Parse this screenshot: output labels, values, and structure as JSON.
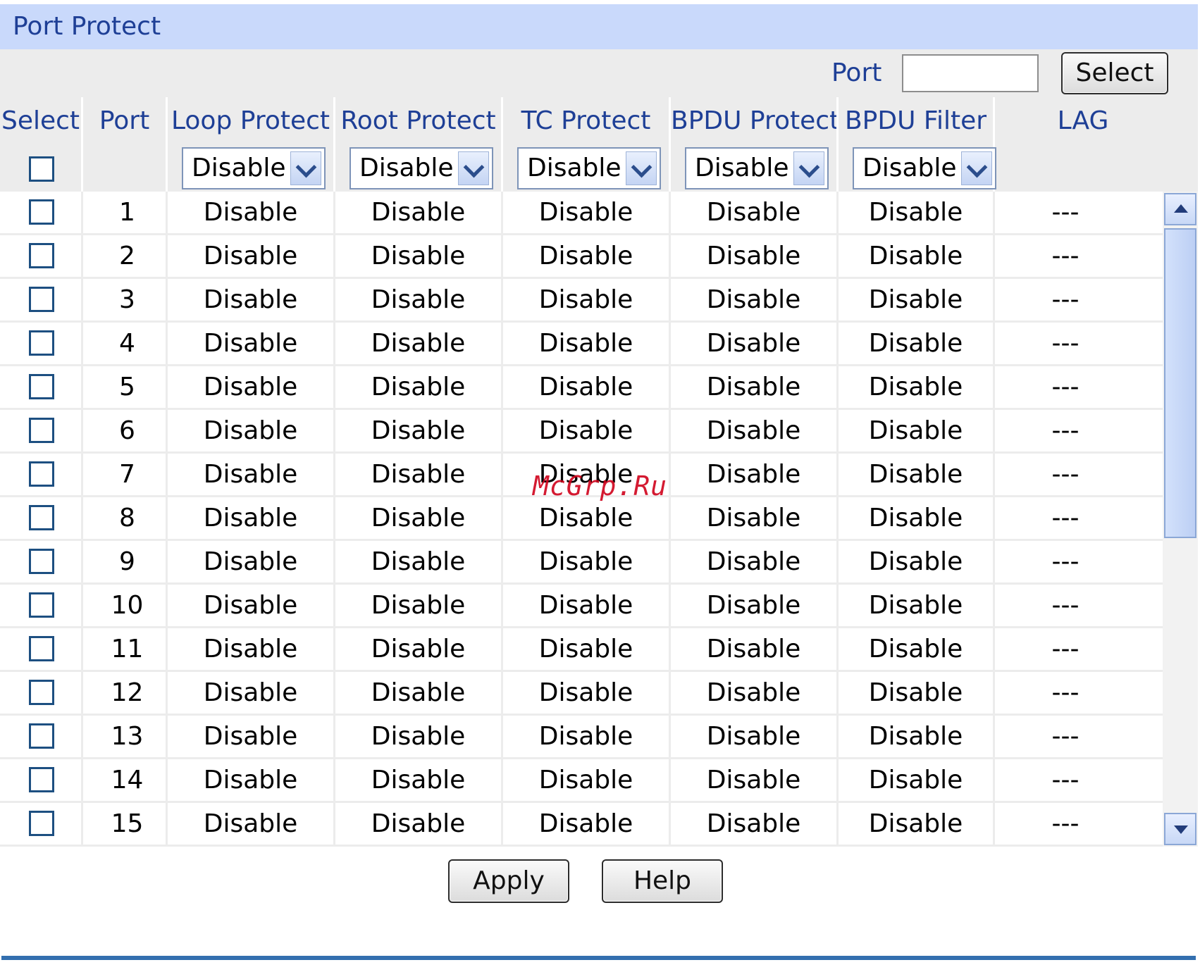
{
  "section": {
    "title": "Port Protect"
  },
  "toolbar": {
    "port_label": "Port",
    "port_value": "",
    "select_label": "Select"
  },
  "columns": {
    "select": "Select",
    "port": "Port",
    "loop": "Loop Protect",
    "root": "Root Protect",
    "tc": "TC Protect",
    "bpdu_protect": "BPDU Protect",
    "bpdu_filter": "BPDU Filter",
    "lag": "LAG"
  },
  "filters": {
    "loop": "Disable",
    "root": "Disable",
    "tc": "Disable",
    "bpdu_protect": "Disable",
    "bpdu_filter": "Disable"
  },
  "rows": [
    {
      "port": "1",
      "loop": "Disable",
      "root": "Disable",
      "tc": "Disable",
      "bpdu_protect": "Disable",
      "bpdu_filter": "Disable",
      "lag": "---"
    },
    {
      "port": "2",
      "loop": "Disable",
      "root": "Disable",
      "tc": "Disable",
      "bpdu_protect": "Disable",
      "bpdu_filter": "Disable",
      "lag": "---"
    },
    {
      "port": "3",
      "loop": "Disable",
      "root": "Disable",
      "tc": "Disable",
      "bpdu_protect": "Disable",
      "bpdu_filter": "Disable",
      "lag": "---"
    },
    {
      "port": "4",
      "loop": "Disable",
      "root": "Disable",
      "tc": "Disable",
      "bpdu_protect": "Disable",
      "bpdu_filter": "Disable",
      "lag": "---"
    },
    {
      "port": "5",
      "loop": "Disable",
      "root": "Disable",
      "tc": "Disable",
      "bpdu_protect": "Disable",
      "bpdu_filter": "Disable",
      "lag": "---"
    },
    {
      "port": "6",
      "loop": "Disable",
      "root": "Disable",
      "tc": "Disable",
      "bpdu_protect": "Disable",
      "bpdu_filter": "Disable",
      "lag": "---"
    },
    {
      "port": "7",
      "loop": "Disable",
      "root": "Disable",
      "tc": "Disable",
      "bpdu_protect": "Disable",
      "bpdu_filter": "Disable",
      "lag": "---"
    },
    {
      "port": "8",
      "loop": "Disable",
      "root": "Disable",
      "tc": "Disable",
      "bpdu_protect": "Disable",
      "bpdu_filter": "Disable",
      "lag": "---"
    },
    {
      "port": "9",
      "loop": "Disable",
      "root": "Disable",
      "tc": "Disable",
      "bpdu_protect": "Disable",
      "bpdu_filter": "Disable",
      "lag": "---"
    },
    {
      "port": "10",
      "loop": "Disable",
      "root": "Disable",
      "tc": "Disable",
      "bpdu_protect": "Disable",
      "bpdu_filter": "Disable",
      "lag": "---"
    },
    {
      "port": "11",
      "loop": "Disable",
      "root": "Disable",
      "tc": "Disable",
      "bpdu_protect": "Disable",
      "bpdu_filter": "Disable",
      "lag": "---"
    },
    {
      "port": "12",
      "loop": "Disable",
      "root": "Disable",
      "tc": "Disable",
      "bpdu_protect": "Disable",
      "bpdu_filter": "Disable",
      "lag": "---"
    },
    {
      "port": "13",
      "loop": "Disable",
      "root": "Disable",
      "tc": "Disable",
      "bpdu_protect": "Disable",
      "bpdu_filter": "Disable",
      "lag": "---"
    },
    {
      "port": "14",
      "loop": "Disable",
      "root": "Disable",
      "tc": "Disable",
      "bpdu_protect": "Disable",
      "bpdu_filter": "Disable",
      "lag": "---"
    },
    {
      "port": "15",
      "loop": "Disable",
      "root": "Disable",
      "tc": "Disable",
      "bpdu_protect": "Disable",
      "bpdu_filter": "Disable",
      "lag": "---"
    }
  ],
  "actions": {
    "apply_label": "Apply",
    "help_label": "Help"
  },
  "watermark": "McGrp.Ru",
  "icons": {
    "dropdown": "chevron-down-icon",
    "scroll_up": "arrow-up-icon",
    "scroll_down": "arrow-down-icon"
  },
  "colors": {
    "header_bg": "#c9d9fb",
    "label_text": "#1e3f96",
    "panel_bg": "#ececec",
    "divider": "#336faf",
    "watermark": "#d0021b"
  }
}
